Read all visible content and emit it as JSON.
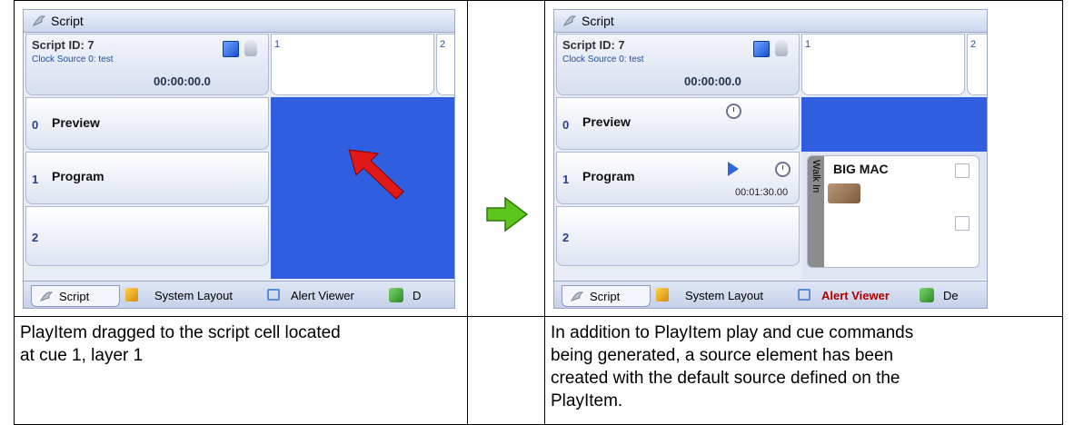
{
  "left": {
    "window": {
      "title": "Script",
      "script_id": "Script ID: 7",
      "clock_source": "Clock Source 0: test",
      "timecode": "00:00:00.0",
      "cues": [
        "1",
        "2"
      ],
      "layers": [
        {
          "num": "0",
          "name": "Preview"
        },
        {
          "num": "1",
          "name": "Program"
        },
        {
          "num": "2",
          "name": ""
        }
      ],
      "tabs": [
        "Script",
        "System Layout",
        "Alert Viewer",
        "D"
      ]
    },
    "caption": [
      "PlayItem dragged to the script cell located",
      "at cue 1, layer 1"
    ]
  },
  "right": {
    "window": {
      "title": "Script",
      "script_id": "Script ID: 7",
      "clock_source": "Clock Source 0: test",
      "timecode": "00:00:00.0",
      "cues": [
        "1",
        "2"
      ],
      "layers": [
        {
          "num": "0",
          "name": "Preview"
        },
        {
          "num": "1",
          "name": "Program",
          "duration": "00:01:30.00"
        },
        {
          "num": "2",
          "name": ""
        }
      ],
      "playitem": {
        "title": "BIG MAC",
        "side_label": "Walk In"
      },
      "tabs": [
        "Script",
        "System Layout",
        "Alert Viewer",
        "De"
      ]
    },
    "caption": [
      "In addition to PlayItem play and cue commands",
      "being generated, a source element has been",
      "created with the default source defined on the",
      "PlayItem."
    ]
  },
  "colors": {
    "grid_blue": "#2f5ee0",
    "arrow_red": "#e01818",
    "arrow_green": "#5cc61c",
    "alert_red": "#b00000"
  }
}
